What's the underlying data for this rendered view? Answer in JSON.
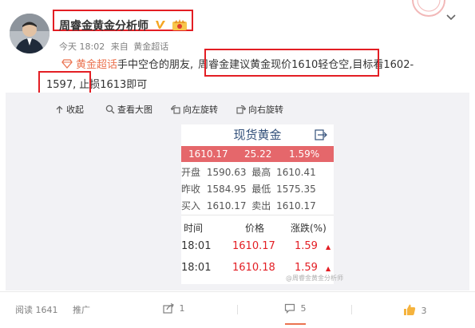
{
  "post": {
    "author": "周睿金黄金分析师",
    "meta": {
      "time": "今天 18:02",
      "source_prefix": "来自",
      "source": "黄金超话"
    },
    "body": {
      "topic": "黄金超话",
      "part1": "手中空仓的朋友,",
      "quote": "周睿金建议黄金现价1610轻仓空,",
      "part2": "目标看1602-",
      "target_end": "1597,",
      "part3": "止损1613即可"
    }
  },
  "media_toolbar": {
    "collapse": "收起",
    "view_large": "查看大图",
    "rotate_left": "向左旋转",
    "rotate_right": "向右旋转"
  },
  "card": {
    "title": "现货黄金",
    "price": "1610.17",
    "change": "25.22",
    "change_pct": "1.59%",
    "stats": [
      {
        "label": "开盘",
        "value": "1590.63",
        "label2": "最高",
        "value2": "1610.41"
      },
      {
        "label": "昨收",
        "value": "1584.95",
        "label2": "最低",
        "value2": "1575.35"
      },
      {
        "label": "买入",
        "value": "1610.17",
        "label2": "卖出",
        "value2": "1610.17"
      }
    ],
    "table_headers": [
      "时间",
      "价格",
      "涨跌(%)"
    ],
    "rows": [
      {
        "time": "18:01",
        "price": "1610.17",
        "change": "1.59"
      },
      {
        "time": "18:01",
        "price": "1610.18",
        "change": "1.59"
      }
    ],
    "watermark": "@周睿金黄金分析师"
  },
  "footer": {
    "reads": "阅读 1641",
    "promote": "推广",
    "forward": "1",
    "comments": "5",
    "likes": "3"
  },
  "colors": {
    "accent": "#eb7350",
    "highlight_box": "#e31e24",
    "price_bar": "#e5676b",
    "card_title": "#33507a",
    "verified": "#f5a623"
  }
}
